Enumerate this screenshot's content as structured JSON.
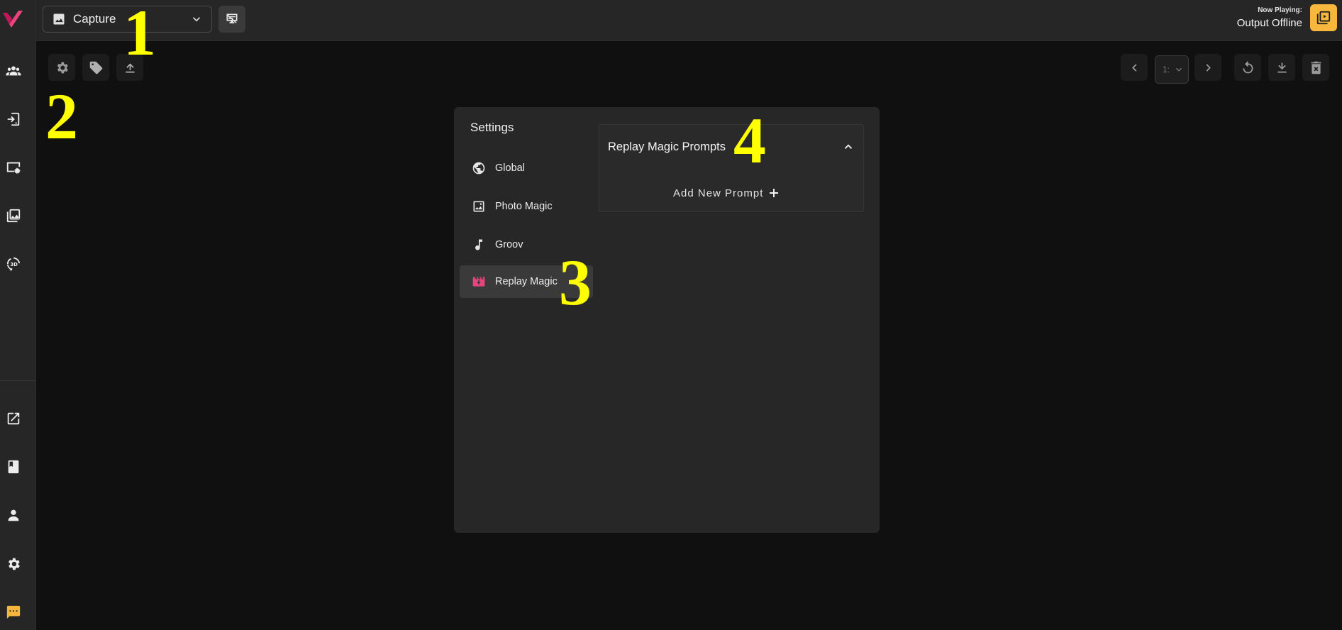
{
  "topbar": {
    "mode_select": {
      "label": "Capture",
      "icon": "image-icon"
    },
    "now_playing_label": "Now Playing:",
    "now_playing_value": "Output Offline"
  },
  "sidebar": {
    "items": [
      {
        "icon": "users-icon"
      },
      {
        "icon": "device-login-icon"
      },
      {
        "icon": "screen-settings-icon"
      },
      {
        "icon": "gallery-icon"
      },
      {
        "icon": "3d-rotate-icon"
      },
      {
        "icon": "open-external-icon"
      },
      {
        "icon": "book-icon"
      },
      {
        "icon": "person-icon"
      },
      {
        "icon": "gear-icon"
      },
      {
        "icon": "chat-icon"
      }
    ],
    "chat_color": "#f6b73c"
  },
  "toolbar": {
    "page_select_value": "1:"
  },
  "settings_panel": {
    "title": "Settings",
    "nav": [
      {
        "label": "Global",
        "icon": "globe-icon",
        "active": false
      },
      {
        "label": "Photo Magic",
        "icon": "photo-icon",
        "active": false
      },
      {
        "label": "Groov",
        "icon": "music-note-icon",
        "active": false
      },
      {
        "label": "Replay Magic",
        "icon": "movie-icon",
        "active": true
      }
    ],
    "prompts_section": {
      "title": "Replay Magic Prompts",
      "add_label": "Add New Prompt"
    }
  },
  "annotations": [
    "1",
    "2",
    "3",
    "4"
  ],
  "colors": {
    "accent_pink": "#e8457f",
    "accent_yellow": "#f6b73c",
    "annotation": "#ffff00"
  }
}
